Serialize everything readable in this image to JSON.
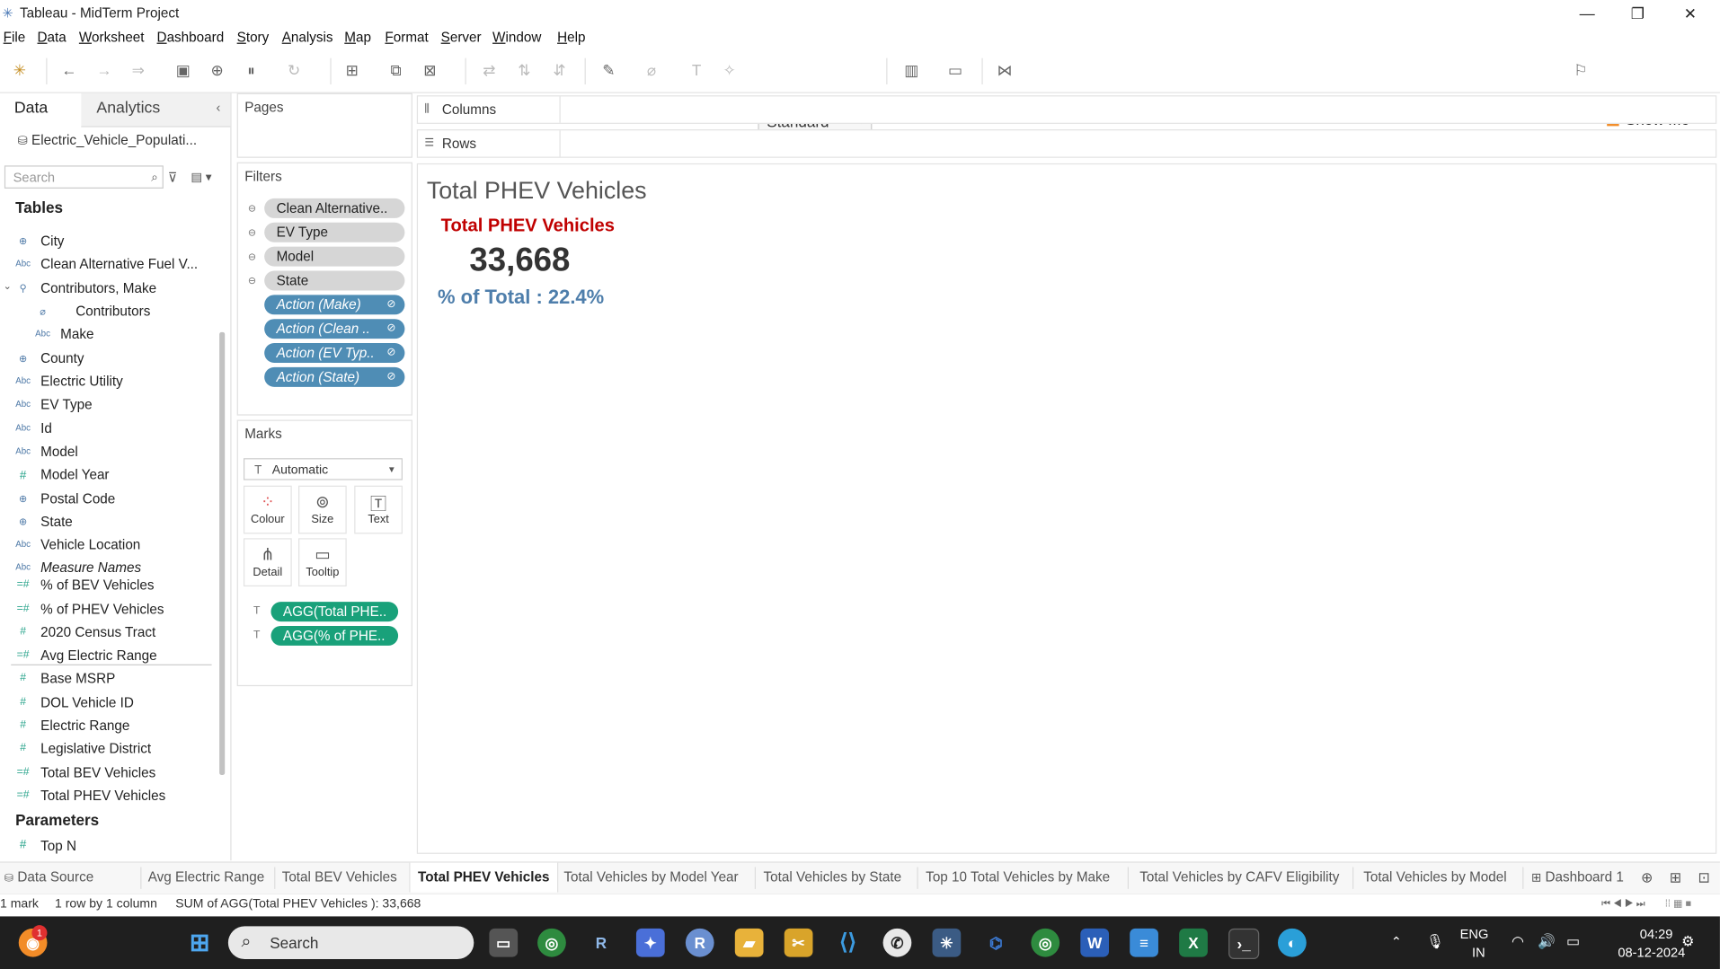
{
  "window": {
    "title": "Tableau - MidTerm Project",
    "minimize": "—",
    "restore": "❐",
    "close": "✕"
  },
  "menu": [
    "File",
    "Data",
    "Worksheet",
    "Dashboard",
    "Story",
    "Analysis",
    "Map",
    "Format",
    "Server",
    "Window",
    "Help"
  ],
  "toolbar": {
    "fit": "Standard",
    "show_me": "Show Me"
  },
  "left_pane": {
    "tab_data": "Data",
    "tab_analytics": "Analytics",
    "datasource": "Electric_Vehicle_Populati...",
    "search_placeholder": "Search",
    "tables_heading": "Tables",
    "dimensions": [
      {
        "name": "City",
        "icon": "globe-icon"
      },
      {
        "name": "Clean Alternative Fuel V...",
        "icon": "abc-icon"
      },
      {
        "name": "Contributors, Make",
        "icon": "hierarchy-icon"
      },
      {
        "name": "Contributors",
        "icon": "group-icon"
      },
      {
        "name": "Make",
        "icon": "abc-icon"
      },
      {
        "name": "County",
        "icon": "globe-icon"
      },
      {
        "name": "Electric Utility",
        "icon": "abc-icon"
      },
      {
        "name": "EV Type",
        "icon": "abc-icon"
      },
      {
        "name": "Id",
        "icon": "abc-icon"
      },
      {
        "name": "Model",
        "icon": "abc-icon"
      },
      {
        "name": "Model Year",
        "icon": "number-icon"
      },
      {
        "name": "Postal Code",
        "icon": "globe-icon"
      },
      {
        "name": "State",
        "icon": "globe-icon"
      },
      {
        "name": "Vehicle Location",
        "icon": "abc-icon"
      },
      {
        "name": "Measure Names",
        "icon": "abc-icon"
      }
    ],
    "measures": [
      {
        "name": "% of BEV Vehicles"
      },
      {
        "name": "% of PHEV Vehicles"
      },
      {
        "name": "2020 Census Tract"
      },
      {
        "name": "Avg Electric Range"
      },
      {
        "name": "Base MSRP"
      },
      {
        "name": "DOL Vehicle ID"
      },
      {
        "name": "Electric Range"
      },
      {
        "name": "Legislative District"
      },
      {
        "name": "Total BEV Vehicles"
      },
      {
        "name": "Total PHEV Vehicles"
      }
    ],
    "parameters_heading": "Parameters",
    "parameters": [
      {
        "name": "Top N"
      }
    ]
  },
  "pages_title": "Pages",
  "filters": {
    "title": "Filters",
    "items": [
      "Clean Alternative..",
      "EV Type",
      "Model",
      "State"
    ],
    "actions": [
      "Action (Make)",
      "Action (Clean ..",
      "Action (EV Typ..",
      "Action (State)"
    ]
  },
  "marks": {
    "title": "Marks",
    "type": "Automatic",
    "buttons": [
      "Colour",
      "Size",
      "Text",
      "Detail",
      "Tooltip"
    ],
    "pills": [
      "AGG(Total PHE..",
      "AGG(% of PHE.."
    ]
  },
  "shelves": {
    "columns": "Columns",
    "rows": "Rows"
  },
  "viz": {
    "sheet_title": "Total PHEV Vehicles",
    "kpi_label": "Total PHEV Vehicles",
    "kpi_value": "33,668",
    "kpi_pct": "% of Total : 22.4%",
    "colors": {
      "label": "#c00000",
      "pct": "#4e7eab"
    }
  },
  "sheet_tabs": [
    "Data Source",
    "Avg Electric Range",
    "Total BEV Vehicles",
    "Total PHEV Vehicles",
    "Total Vehicles by Model Year",
    "Total Vehicles by State",
    "Top 10 Total Vehicles by Make",
    "Total Vehicles by CAFV Eligibility",
    "Total Vehicles by Model",
    "Dashboard 1"
  ],
  "active_tab": "Total PHEV Vehicles",
  "status": {
    "marks": "1 mark",
    "rows": "1 row  by  1 column",
    "sum": "SUM of AGG(Total PHEV Vehicles ): 33,668"
  },
  "taskbar": {
    "search": "Search",
    "lang_top": "ENG",
    "lang_bottom": "IN",
    "time": "04:29",
    "date": "08-12-2024",
    "notification_badge": "1"
  }
}
